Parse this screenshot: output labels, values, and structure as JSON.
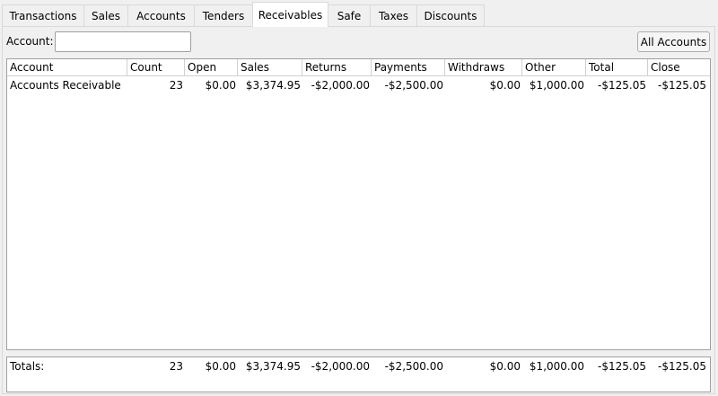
{
  "tabs": [
    "Transactions",
    "Sales",
    "Accounts",
    "Tenders",
    "Receivables",
    "Safe",
    "Taxes",
    "Discounts"
  ],
  "active_tab": "Receivables",
  "filter": {
    "label": "Account:",
    "value": "",
    "button": "All Accounts"
  },
  "columns": [
    "Account",
    "Count",
    "Open",
    "Sales",
    "Returns",
    "Payments",
    "Withdraws",
    "Other",
    "Total",
    "Close"
  ],
  "rows": [
    [
      "Accounts Receivable",
      "23",
      "$0.00",
      "$3,374.95",
      "-$2,000.00",
      "-$2,500.00",
      "$0.00",
      "$1,000.00",
      "-$125.05",
      "-$125.05"
    ]
  ],
  "totals": [
    "Totals:",
    "23",
    "$0.00",
    "$3,374.95",
    "-$2,000.00",
    "-$2,500.00",
    "$0.00",
    "$1,000.00",
    "-$125.05",
    "-$125.05"
  ]
}
